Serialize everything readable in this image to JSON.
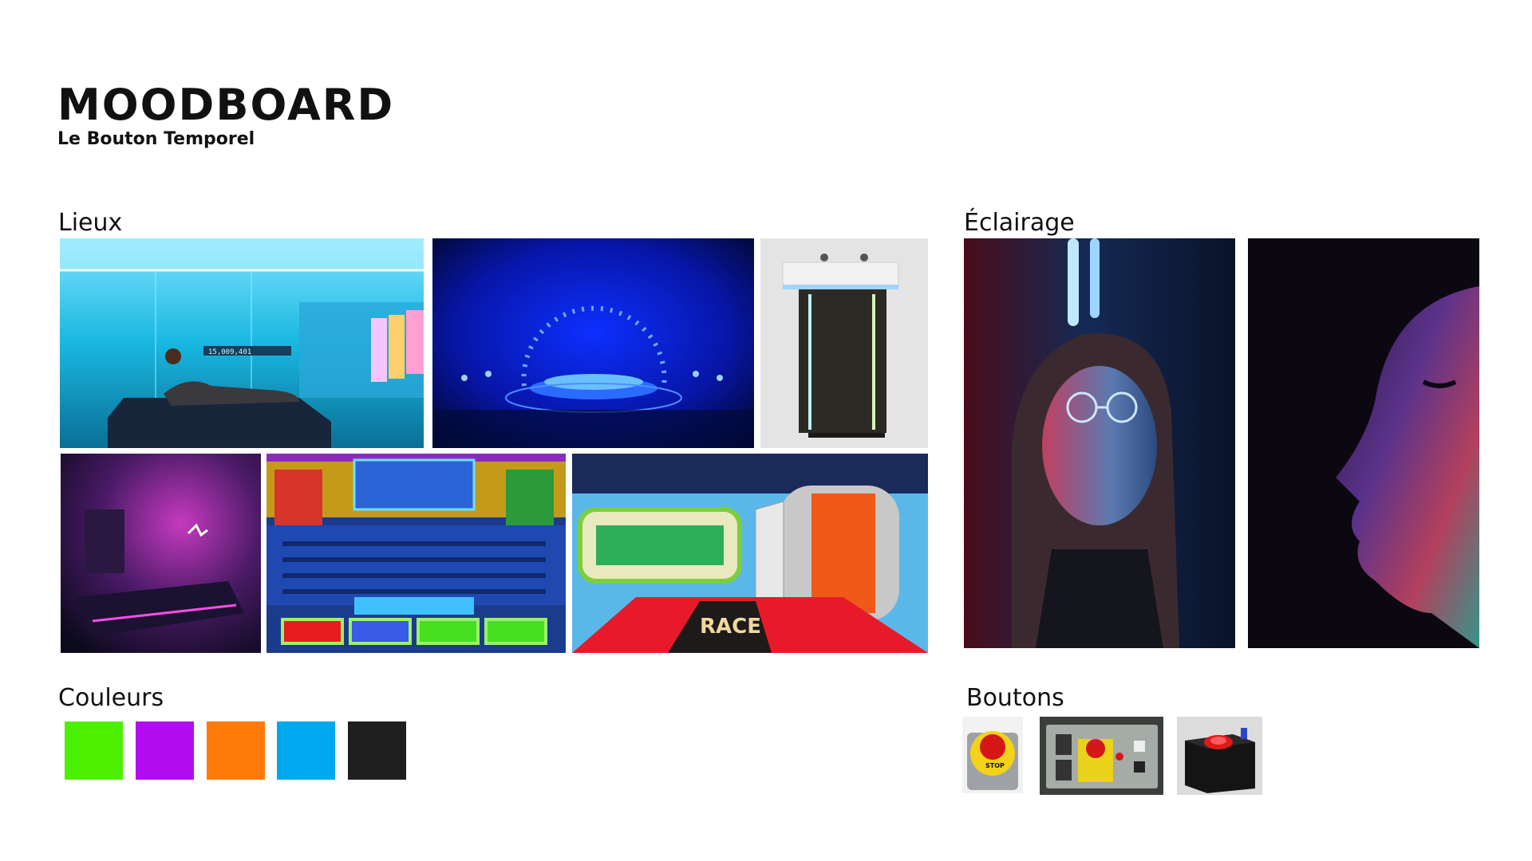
{
  "header": {
    "title": "MOODBOARD",
    "subtitle": "Le Bouton Temporel"
  },
  "sections": {
    "lieux": "Lieux",
    "eclairage": "Éclairage",
    "couleurs": "Couleurs",
    "boutons": "Boutons"
  },
  "stage_display": {
    "counter": "15,009,401"
  },
  "button_photo": {
    "stop_label": "STOP"
  },
  "game_show": {
    "race_sign": "RACE"
  },
  "palette": [
    "#4cf000",
    "#b10df0",
    "#ff7a0a",
    "#00a8f0",
    "#1f1f1f"
  ]
}
